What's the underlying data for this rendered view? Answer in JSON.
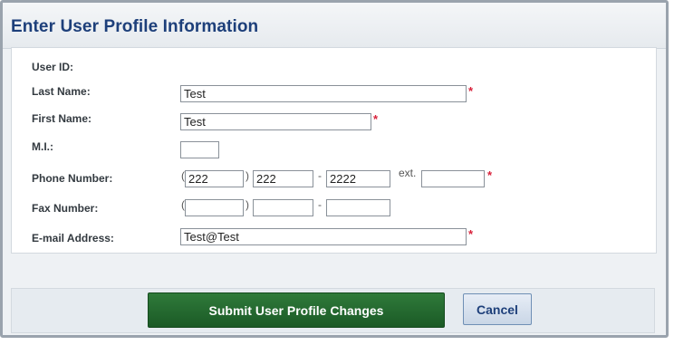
{
  "dialog": {
    "title": "Enter User Profile Information"
  },
  "form": {
    "required_marker": "*",
    "fields": {
      "user_id": {
        "label": "User ID:",
        "value": ""
      },
      "last_name": {
        "label": "Last Name:",
        "value": "Test"
      },
      "first_name": {
        "label": "First Name:",
        "value": "Test"
      },
      "mi": {
        "label": "M.I.:",
        "value": ""
      },
      "phone": {
        "label": "Phone Number:",
        "area": "222",
        "prefix": "222",
        "line": "2222",
        "ext_label": "ext.",
        "ext": ""
      },
      "fax": {
        "label": "Fax Number:",
        "area": "",
        "prefix": "",
        "line": ""
      },
      "email": {
        "label": "E-mail Address:",
        "value": "Test@Test"
      }
    },
    "punct": {
      "open_paren": "(",
      "close_paren": ")",
      "dash": "-"
    }
  },
  "footer": {
    "submit_label": "Submit User Profile Changes",
    "cancel_label": "Cancel"
  },
  "colors": {
    "title": "#1d3f7a",
    "required": "#d8213a",
    "submit_bg": "#1f6a2d"
  }
}
